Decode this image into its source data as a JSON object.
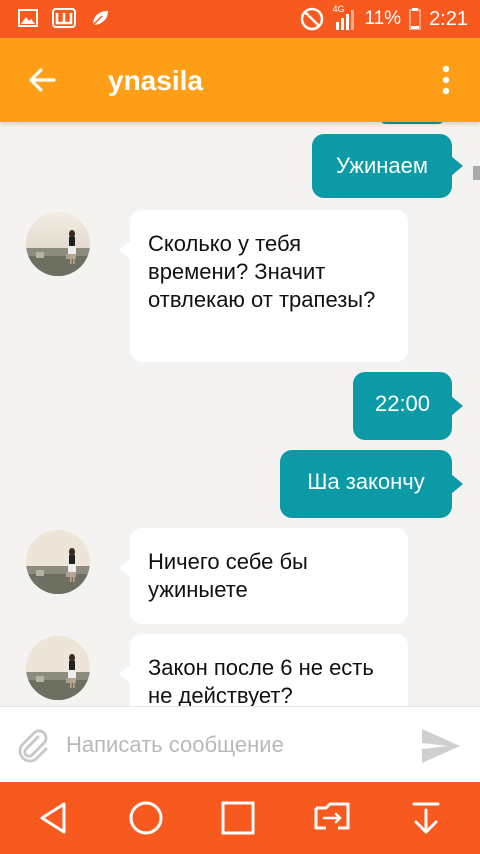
{
  "status_bar": {
    "network": "4G",
    "battery": "11%",
    "time": "2:21",
    "icons": [
      "image-icon",
      "w-app-icon",
      "leaf-icon",
      "do-not-disturb-icon",
      "signal-icon",
      "battery-icon"
    ]
  },
  "header": {
    "title": "ynasila",
    "back_icon": "arrow-back-icon",
    "menu_icon": "more-vert-icon",
    "color": "#ff9f18"
  },
  "messages": [
    {
      "side": "out",
      "text": "Ужинаем"
    },
    {
      "side": "in",
      "text": "Сколько у тебя времени? Значит отвлекаю от трапезы?"
    },
    {
      "side": "out",
      "text": "22:00"
    },
    {
      "side": "out",
      "text": "Ша закончу"
    },
    {
      "side": "in",
      "text": "Ничего себе бы ужиныете"
    },
    {
      "side": "in",
      "text": "Закон после 6 не есть не действует?"
    }
  ],
  "composer": {
    "placeholder": "Написать сообщение",
    "value": "",
    "attach_icon": "paperclip-icon",
    "send_icon": "send-icon"
  },
  "nav_bar": {
    "icons": [
      "back-triangle-icon",
      "home-circle-icon",
      "recents-square-icon",
      "screen-switch-icon",
      "download-arrow-icon"
    ],
    "color": "#f7591f"
  },
  "colors": {
    "outgoing_bubble": "#0c9aa7",
    "incoming_bubble": "#ffffff",
    "chat_background": "#f4f3f1"
  }
}
